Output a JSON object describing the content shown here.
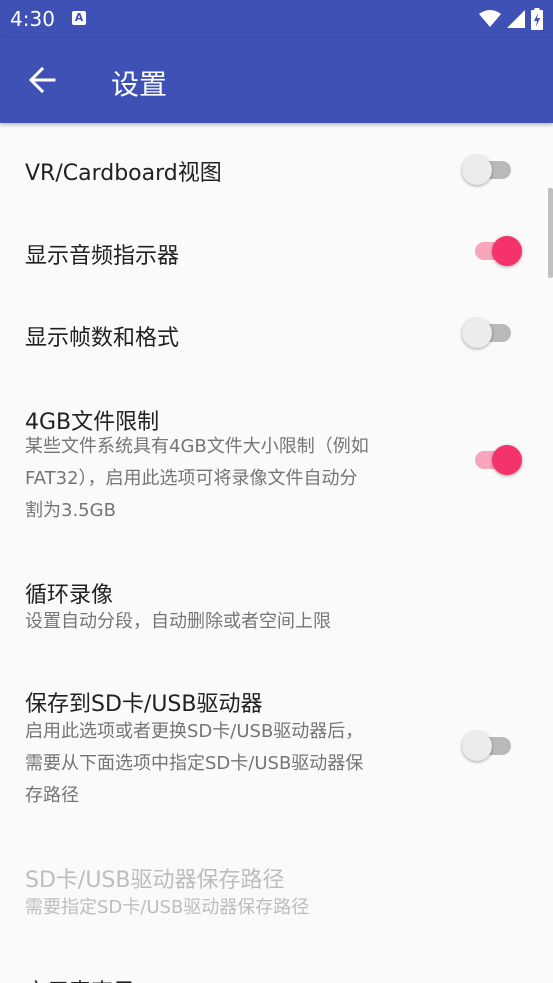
{
  "status_bar": {
    "time": "4:30",
    "notification_icon": "a-notification-icon",
    "icons": [
      "wifi-icon",
      "signal-icon",
      "battery-charging-icon"
    ]
  },
  "app_bar": {
    "back_icon": "arrow-back-icon",
    "title": "设置"
  },
  "colors": {
    "primary": "#3f51b5",
    "accent": "#f3336a",
    "background": "#fafafa"
  },
  "preferences": [
    {
      "title": "VR/Cardboard视图",
      "enabled": false
    },
    {
      "title": "显示音频指示器",
      "enabled": true
    },
    {
      "title": "显示帧数和格式",
      "enabled": false
    },
    {
      "title": "4GB文件限制",
      "summary_lines": [
        "某些文件系统具有4GB文件大小限制（例如",
        "FAT32），启用此选项可将录像文件自动分",
        "割为3.5GB"
      ],
      "enabled": true
    },
    {
      "title": "循环录像",
      "summary": "设置自动分段，自动删除或者空间上限"
    },
    {
      "title": "保存到SD卡/USB驱动器",
      "summary_lines": [
        "启用此选项或者更换SD卡/USB驱动器后，",
        "需要从下面选项中指定SD卡/USB驱动器保",
        "存路径"
      ],
      "enabled": false
    },
    {
      "title": "SD卡/USB驱动器保存路径",
      "summary": "需要指定SD卡/USB驱动器保存路径",
      "disabled": true
    },
    {
      "title": "启用麦克风"
    }
  ]
}
